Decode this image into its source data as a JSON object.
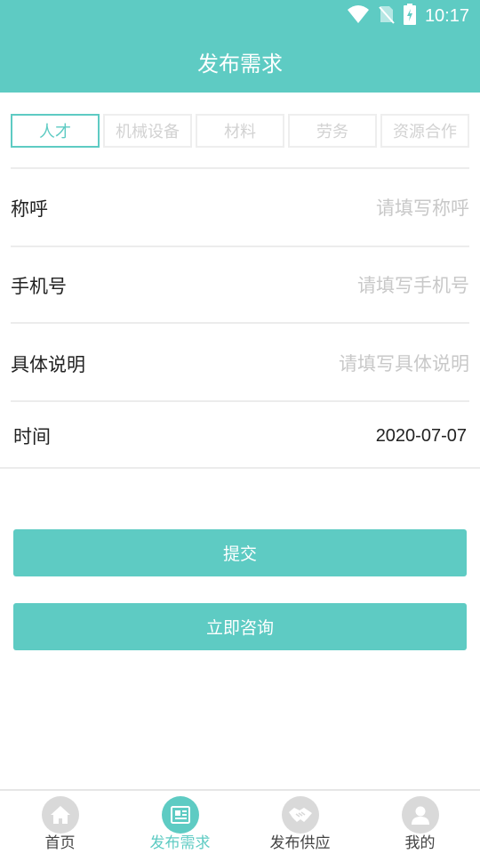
{
  "status": {
    "time": "10:17"
  },
  "header": {
    "title": "发布需求"
  },
  "tabs": [
    {
      "label": "人才",
      "active": true
    },
    {
      "label": "机械设备",
      "active": false
    },
    {
      "label": "材料",
      "active": false
    },
    {
      "label": "劳务",
      "active": false
    },
    {
      "label": "资源合作",
      "active": false
    }
  ],
  "form": {
    "name": {
      "label": "称呼",
      "value": "",
      "placeholder": "请填写称呼"
    },
    "phone": {
      "label": "手机号",
      "value": "",
      "placeholder": "请填写手机号"
    },
    "detail": {
      "label": "具体说明",
      "value": "",
      "placeholder": "请填写具体说明"
    },
    "time": {
      "label": "时间",
      "value": "2020-07-07"
    }
  },
  "buttons": {
    "submit": "提交",
    "consult": "立即咨询"
  },
  "nav": [
    {
      "label": "首页",
      "icon": "home-icon",
      "active": false
    },
    {
      "label": "发布需求",
      "icon": "document-icon",
      "active": true
    },
    {
      "label": "发布供应",
      "icon": "handshake-icon",
      "active": false
    },
    {
      "label": "我的",
      "icon": "user-icon",
      "active": false
    }
  ],
  "colors": {
    "accent": "#5ecbc3",
    "placeholder": "#c8c8c8",
    "inactive_icon": "#d9d9d9"
  }
}
